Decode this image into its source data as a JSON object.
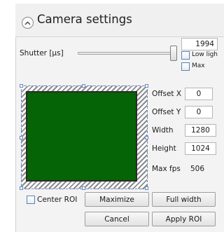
{
  "header": {
    "title": "Camera settings",
    "collapse_icon": "chevron-up-icon"
  },
  "shutter": {
    "label": "Shutter [µs]",
    "value": "1994",
    "slider_level": 0.98,
    "low_light_label": "Low ligh",
    "max_label": "Max"
  },
  "roi": {
    "offset_x_label": "Offset X",
    "offset_x": "0",
    "offset_y_label": "Offset Y",
    "offset_y": "0",
    "width_label": "Width",
    "width": "1280",
    "height_label": "Height",
    "height": "1024",
    "max_fps_label": "Max fps",
    "max_fps": "506",
    "fill_color": "#056405"
  },
  "buttons": {
    "center_roi_label": "Center ROI",
    "maximize": "Maximize",
    "full_width": "Full width",
    "cancel": "Cancel",
    "apply_roi": "Apply ROI"
  }
}
